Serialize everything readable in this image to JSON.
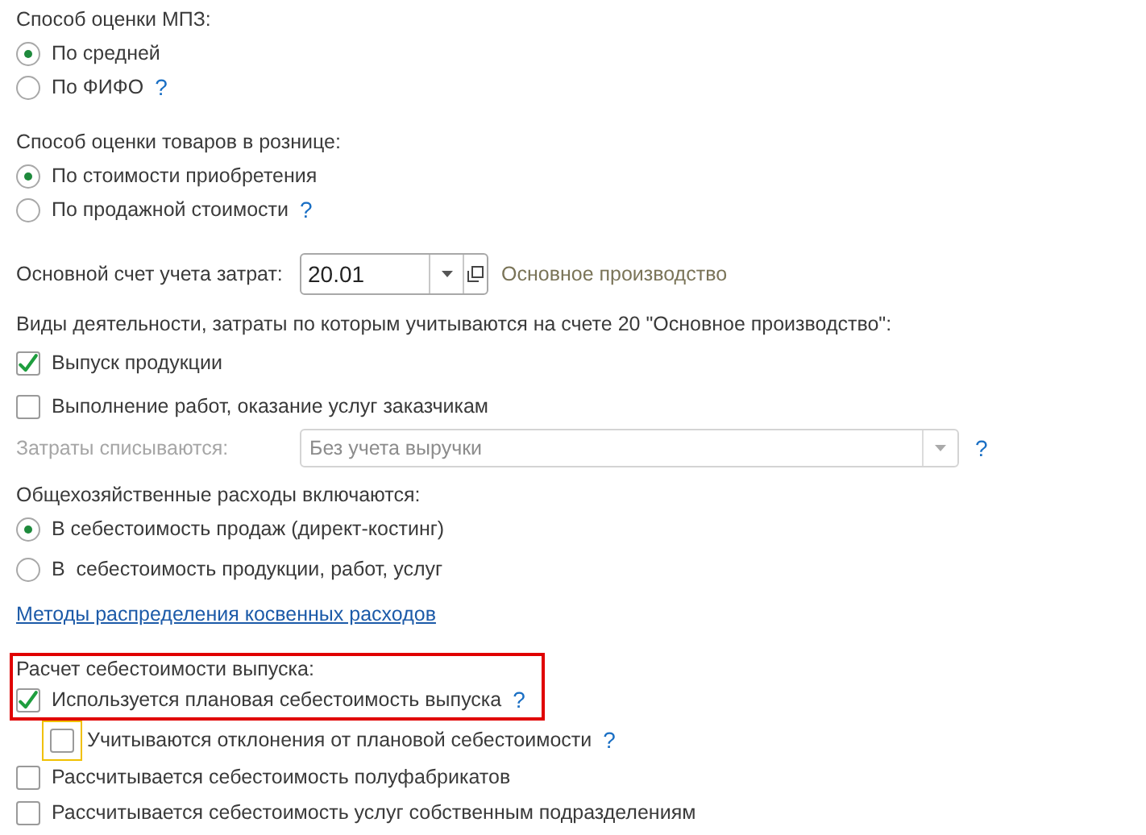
{
  "inventory_valuation": {
    "label": "Способ оценки МПЗ:",
    "options": [
      {
        "label": "По средней",
        "selected": true
      },
      {
        "label": "По ФИФО",
        "selected": false,
        "help": "?"
      }
    ]
  },
  "retail_valuation": {
    "label": "Способ оценки товаров в рознице:",
    "options": [
      {
        "label": "По стоимости приобретения",
        "selected": true
      },
      {
        "label": "По продажной стоимости",
        "selected": false,
        "help": "?"
      }
    ]
  },
  "cost_account": {
    "label": "Основной счет учета затрат:",
    "value": "20.01",
    "description": "Основное производство"
  },
  "activities": {
    "label": "Виды деятельности, затраты по которым учитываются на счете 20 \"Основное производство\":",
    "options": [
      {
        "label": "Выпуск продукции",
        "checked": true
      },
      {
        "label": "Выполнение работ, оказание услуг заказчикам",
        "checked": false
      }
    ]
  },
  "write_off": {
    "label": "Затраты списываются:",
    "value": "Без учета выручки",
    "disabled": true,
    "help": "?"
  },
  "overhead": {
    "label": "Общехозяйственные расходы включаются:",
    "options": [
      {
        "label": "В себестоимость продаж (директ-костинг)",
        "selected": true
      },
      {
        "label": "В  себестоимость продукции, работ, услуг",
        "selected": false
      }
    ]
  },
  "allocation_link": "Методы распределения косвенных расходов",
  "cost_calculation": {
    "label": "Расчет себестоимости выпуска:",
    "highlighted": true,
    "options": [
      {
        "label": "Используется плановая себестоимость выпуска",
        "checked": true,
        "help": "?"
      }
    ]
  },
  "more_options": [
    {
      "kind": "nested",
      "label": "Учитываются отклонения от плановой себестоимости",
      "checked": false,
      "help": "?",
      "focused": true
    },
    {
      "kind": "option",
      "label": "Рассчитывается себестоимость полуфабрикатов",
      "checked": false
    },
    {
      "kind": "option",
      "label": "Рассчитывается себестоимость услуг собственным подразделениям",
      "checked": false
    }
  ]
}
